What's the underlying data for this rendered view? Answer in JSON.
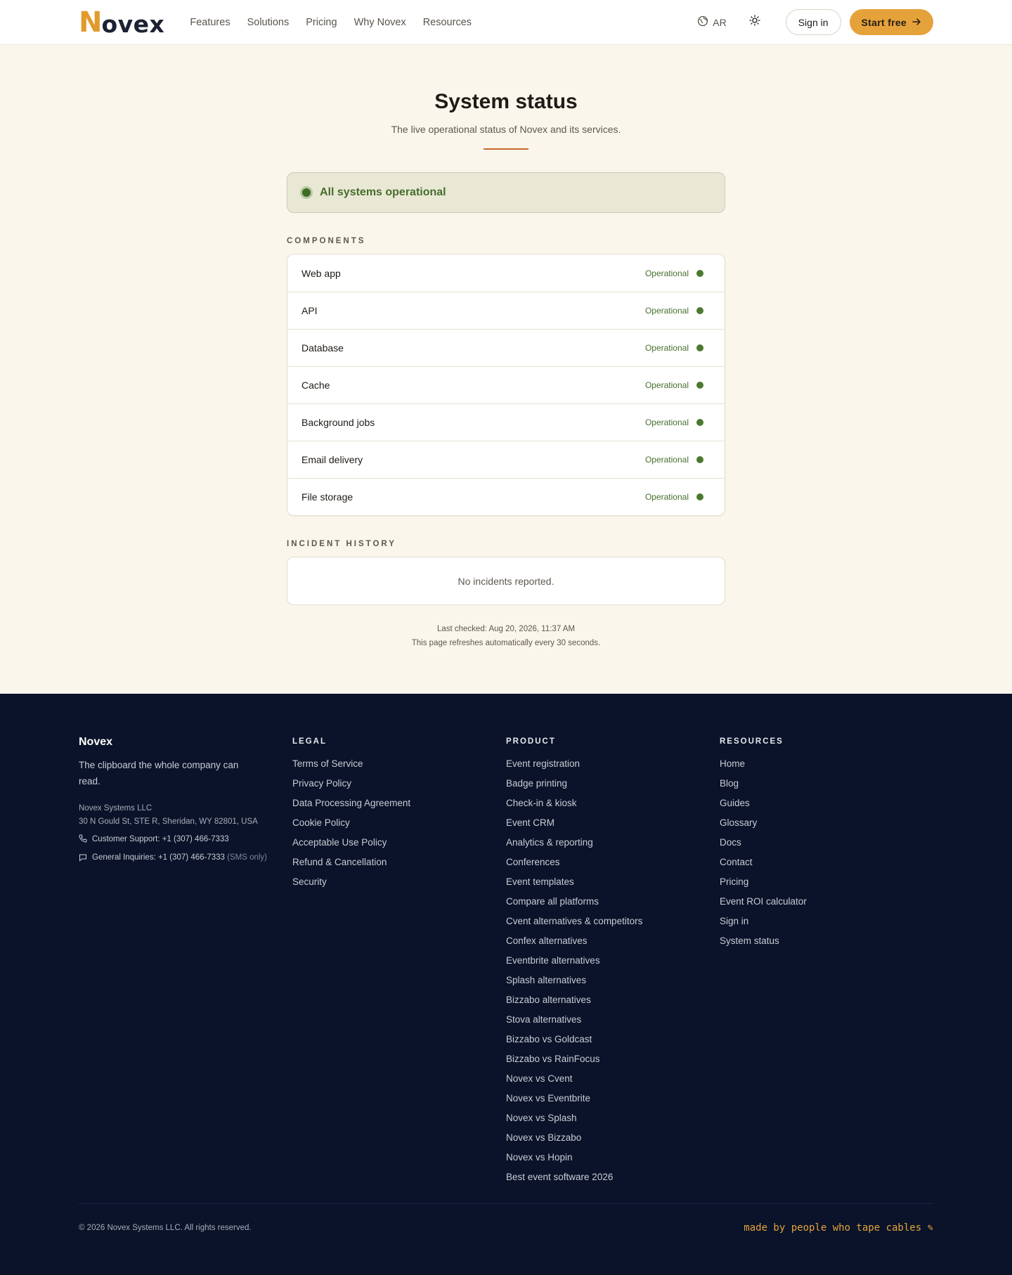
{
  "header": {
    "logo_n": "N",
    "logo_rest": "ovex",
    "nav": [
      "Features",
      "Solutions",
      "Pricing",
      "Why Novex",
      "Resources"
    ],
    "lang_label": "AR",
    "signin_label": "Sign in",
    "startfree_label": "Start free",
    "colors": {
      "accent": "#e6a23a",
      "logo_n": "#e19a2c",
      "logo_text": "#1c2233"
    }
  },
  "main": {
    "title": "System status",
    "subtitle": "The live operational status of Novex and its services.",
    "banner_text": "All systems operational",
    "components_label": "COMPONENTS",
    "components": [
      {
        "name": "Web app",
        "status": "Operational"
      },
      {
        "name": "API",
        "status": "Operational"
      },
      {
        "name": "Database",
        "status": "Operational"
      },
      {
        "name": "Cache",
        "status": "Operational"
      },
      {
        "name": "Background jobs",
        "status": "Operational"
      },
      {
        "name": "Email delivery",
        "status": "Operational"
      },
      {
        "name": "File storage",
        "status": "Operational"
      }
    ],
    "incidents_label": "INCIDENT HISTORY",
    "no_incidents": "No incidents reported.",
    "last_checked": "Last checked: Aug 20, 2026, 11:37 AM",
    "refresh_note": "This page refreshes automatically every 30 seconds.",
    "colors": {
      "operational": "#466e2d",
      "banner_bg": "#e9e8d5"
    }
  },
  "footer": {
    "brand": "Novex",
    "tagline": "The clipboard the whole company can read.",
    "company": "Novex Systems LLC",
    "address": "30 N Gould St, STE R, Sheridan, WY 82801, USA",
    "support": "Customer Support: +1 (307) 466-7333",
    "inquiries": "General Inquiries: +1 (307) 466-7333",
    "inquiries_note": "(SMS only)",
    "legal_head": "LEGAL",
    "legal": [
      "Terms of Service",
      "Privacy Policy",
      "Data Processing Agreement",
      "Cookie Policy",
      "Acceptable Use Policy",
      "Refund & Cancellation",
      "Security"
    ],
    "product_head": "PRODUCT",
    "product": [
      "Event registration",
      "Badge printing",
      "Check-in & kiosk",
      "Event CRM",
      "Analytics & reporting",
      "Conferences",
      "Event templates",
      "Compare all platforms",
      "Cvent alternatives & competitors",
      "Confex alternatives",
      "Eventbrite alternatives",
      "Splash alternatives",
      "Bizzabo alternatives",
      "Stova alternatives",
      "Bizzabo vs Goldcast",
      "Bizzabo vs RainFocus",
      "Novex vs Cvent",
      "Novex vs Eventbrite",
      "Novex vs Splash",
      "Novex vs Bizzabo",
      "Novex vs Hopin",
      "Best event software 2026"
    ],
    "resources_head": "RESOURCES",
    "resources": [
      "Home",
      "Blog",
      "Guides",
      "Glossary",
      "Docs",
      "Contact",
      "Pricing",
      "Event ROI calculator",
      "Sign in",
      "System status"
    ],
    "copyright": "© 2026 Novex Systems LLC. All rights reserved.",
    "madeby": "made by people who tape cables ✎",
    "colors": {
      "bg": "#0a1329"
    }
  }
}
